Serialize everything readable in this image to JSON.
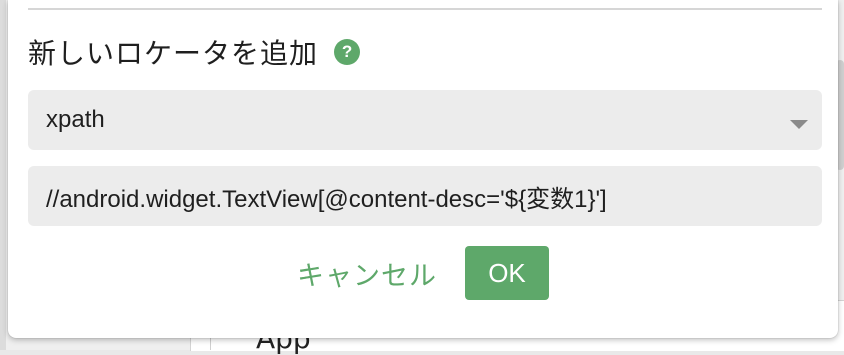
{
  "background": {
    "label_text": "App"
  },
  "dialog": {
    "title": "新しいロケータを追加",
    "help_icon": "?",
    "locator_type": {
      "selected": "xpath",
      "icon": "chevron-down-icon"
    },
    "locator_value": "//android.widget.TextView[@content-desc='${変数1}']",
    "cancel_label": "キャンセル",
    "ok_label": "OK"
  },
  "colors": {
    "accent": "#5ea86a",
    "field_bg": "#ececec",
    "text": "#1f1f1f"
  }
}
